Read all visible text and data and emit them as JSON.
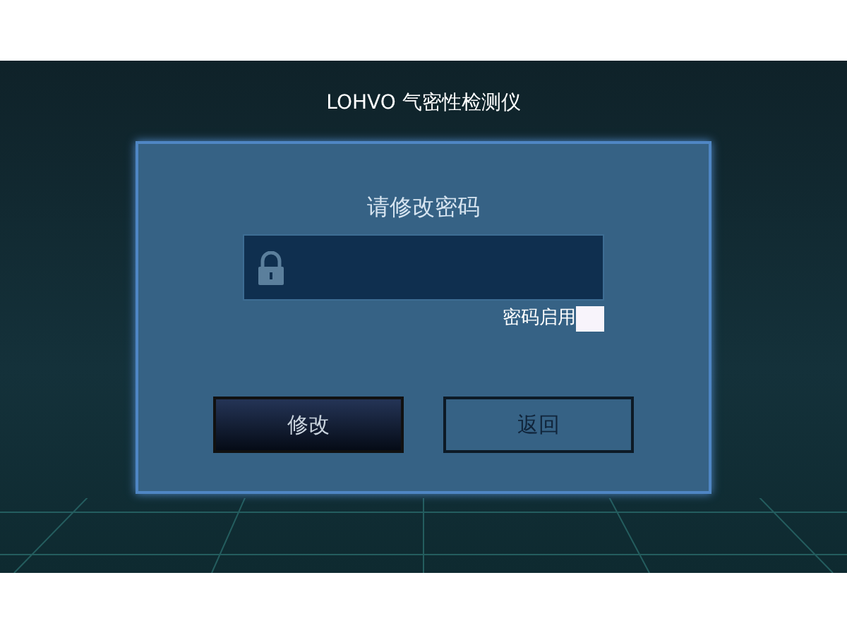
{
  "title": "LOHVO 气密性检测仪",
  "dialog": {
    "heading": "请修改密码",
    "enable_password": {
      "label": "密码启用",
      "checked": false
    },
    "buttons": [
      {
        "label": "修改",
        "kind": "primary"
      },
      {
        "label": "返回",
        "kind": "outline"
      }
    ]
  }
}
